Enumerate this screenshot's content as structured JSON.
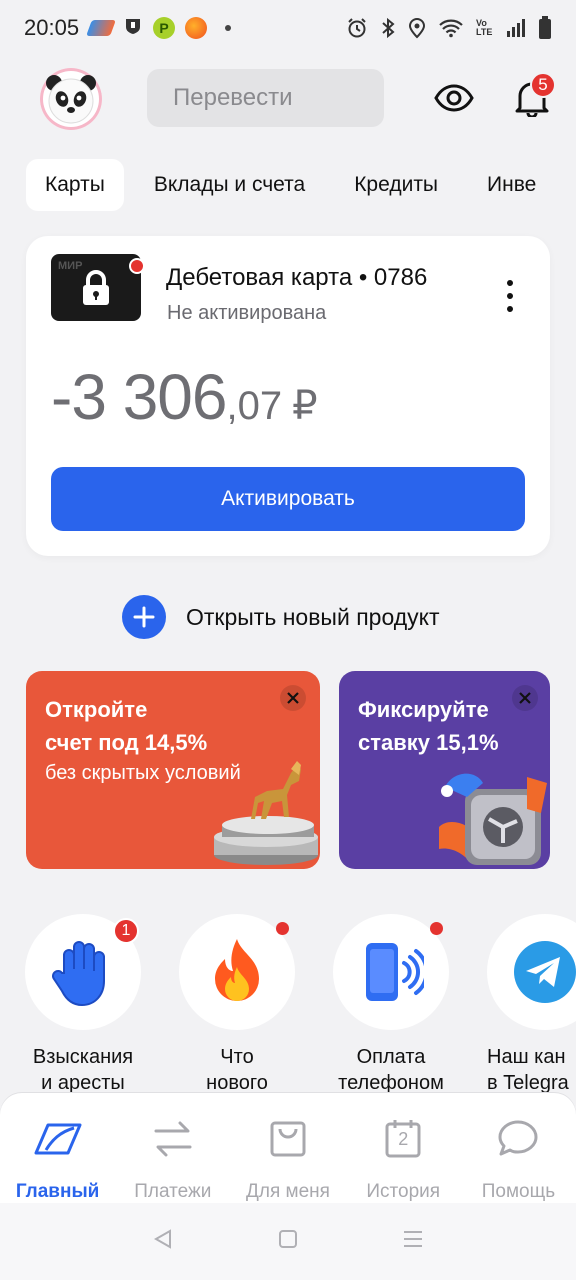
{
  "status_bar": {
    "time": "20:05",
    "network": "Vo LTE",
    "icons": [
      "tinkoff-app-icon",
      "shield-app-icon",
      "p-app-icon",
      "orange-app-icon",
      "dot-icon",
      "alarm-icon",
      "bluetooth-icon",
      "location-icon",
      "wifi-icon",
      "signal-icon",
      "battery-icon"
    ]
  },
  "header": {
    "search_placeholder": "Перевести",
    "notifications_count": "5"
  },
  "tabs": [
    {
      "label": "Карты",
      "active": true
    },
    {
      "label": "Вклады и счета",
      "active": false
    },
    {
      "label": "Кредиты",
      "active": false
    },
    {
      "label": "Инве",
      "active": false
    }
  ],
  "card": {
    "title": "Дебетовая карта • 0786",
    "status": "Не активирована",
    "thumb_label": "МИР",
    "balance_int": "-3 306",
    "balance_frac": ",07",
    "currency": "₽",
    "action_label": "Активировать"
  },
  "open_product": {
    "label": "Открыть новый продукт"
  },
  "promos": [
    {
      "title_line1": "Откройте",
      "title_line2": "счет под 14,5%",
      "subtitle": "без скрытых условий",
      "color": "#e8573a"
    },
    {
      "title_line1": "Фиксируйте",
      "title_line2": "ставку 15,1%",
      "subtitle": "",
      "color": "#5a3fa3"
    }
  ],
  "stories": [
    {
      "line1": "Взыскания",
      "line2": "и аресты",
      "badge": "1"
    },
    {
      "line1": "Что",
      "line2": "нового"
    },
    {
      "line1": "Оплата",
      "line2": "телефоном"
    },
    {
      "line1": "Наш кан",
      "line2": "в Telegra"
    }
  ],
  "bottom_nav": [
    {
      "label": "Главный",
      "icon": "home-icon",
      "active": true
    },
    {
      "label": "Платежи",
      "icon": "transfer-arrows-icon",
      "active": false
    },
    {
      "label": "Для меня",
      "icon": "shopping-bag-icon",
      "active": false
    },
    {
      "label": "История",
      "icon": "calendar-icon",
      "calendar_day": "2",
      "active": false
    },
    {
      "label": "Помощь",
      "icon": "chat-bubble-icon",
      "active": false
    }
  ],
  "colors": {
    "accent": "#2a64ec",
    "badge": "#e4332f",
    "background": "#f2f2f4"
  }
}
